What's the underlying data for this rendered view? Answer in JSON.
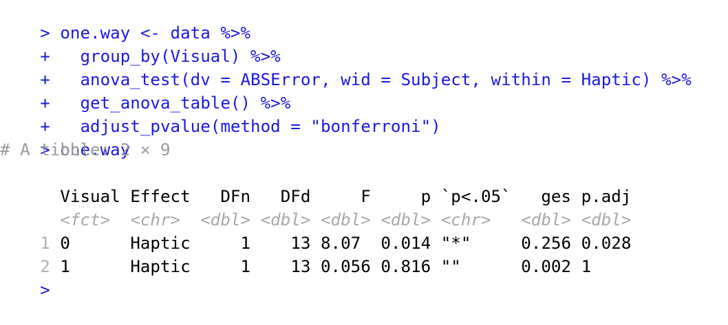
{
  "console": {
    "prompt_char": ">",
    "continuation_char": "+",
    "commands": [
      "one.way <- data %>%",
      "  group_by(Visual) %>%",
      "  anova_test(dv = ABSError, wid = Subject, within = Haptic) %>%",
      "  get_anova_table() %>%",
      "  adjust_pvalue(method = \"bonferroni\")"
    ],
    "print_command": "one.way",
    "tibble_comment": "# A tibble: 2 × 9",
    "columns": [
      "Visual",
      "Effect",
      "DFn",
      "DFd",
      "F",
      "p",
      "`p<.05`",
      "ges",
      "p.adj"
    ],
    "types": [
      "<fct>",
      "<chr>",
      "<dbl>",
      "<dbl>",
      "<dbl>",
      "<dbl>",
      "<chr>",
      "<dbl>",
      "<dbl>"
    ],
    "rows": [
      {
        "num": "1",
        "cells": [
          "0",
          "Haptic",
          "1",
          "13",
          "8.07",
          "0.014",
          "\"*\"",
          "0.256",
          "0.028"
        ]
      },
      {
        "num": "2",
        "cells": [
          "1",
          "Haptic",
          "1",
          "13",
          "0.056",
          "0.816",
          "\"\"",
          "0.002",
          "1"
        ]
      }
    ]
  },
  "colors": {
    "command": "#1a1adf",
    "comment": "#9a9a9a",
    "output": "#000000",
    "type_hint": "#a8a8a8"
  }
}
